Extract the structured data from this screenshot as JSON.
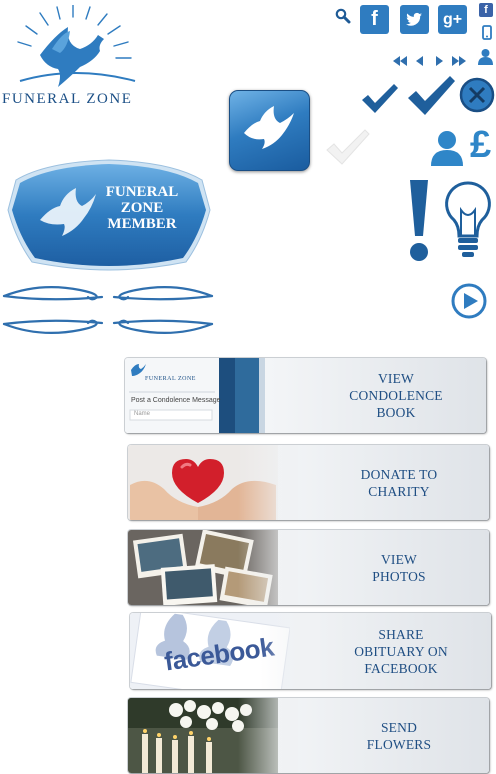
{
  "logo": {
    "brand_text": "FUNERAL ZONE"
  },
  "badge": {
    "line1": "FUNERAL",
    "line2": "ZONE",
    "line3": "MEMBER"
  },
  "social": {
    "facebook": "f",
    "twitter": "t",
    "google": "g+"
  },
  "icons": {
    "search": "search-icon",
    "rewind": "rewind-icon",
    "prev": "prev-icon",
    "next": "next-icon",
    "fast_forward": "fast-forward-icon",
    "user": "user-icon",
    "mobile": "mobile-icon",
    "pound": "£",
    "exclamation": "!",
    "bulb": "lightbulb-icon",
    "play": "play-icon"
  },
  "buttons": [
    {
      "line1": "VIEW",
      "line2": "CONDOLENCE",
      "line3": "BOOK",
      "thumb_caption": "Post a Condolence Message",
      "thumb_brand": "FUNERAL ZONE",
      "thumb_field": "Name"
    },
    {
      "line1": "DONATE TO",
      "line2": "CHARITY"
    },
    {
      "line1": "VIEW",
      "line2": "PHOTOS"
    },
    {
      "line1": "SHARE",
      "line2": "OBITUARY ON",
      "line3": "FACEBOOK",
      "thumb_brand": "facebook"
    },
    {
      "line1": "SEND",
      "line2": "FLOWERS"
    }
  ],
  "colors": {
    "accent": "#2f7cc0",
    "dark_blue": "#1b4f86",
    "text_blue": "#1f4e83",
    "facebook": "#3b5998"
  }
}
